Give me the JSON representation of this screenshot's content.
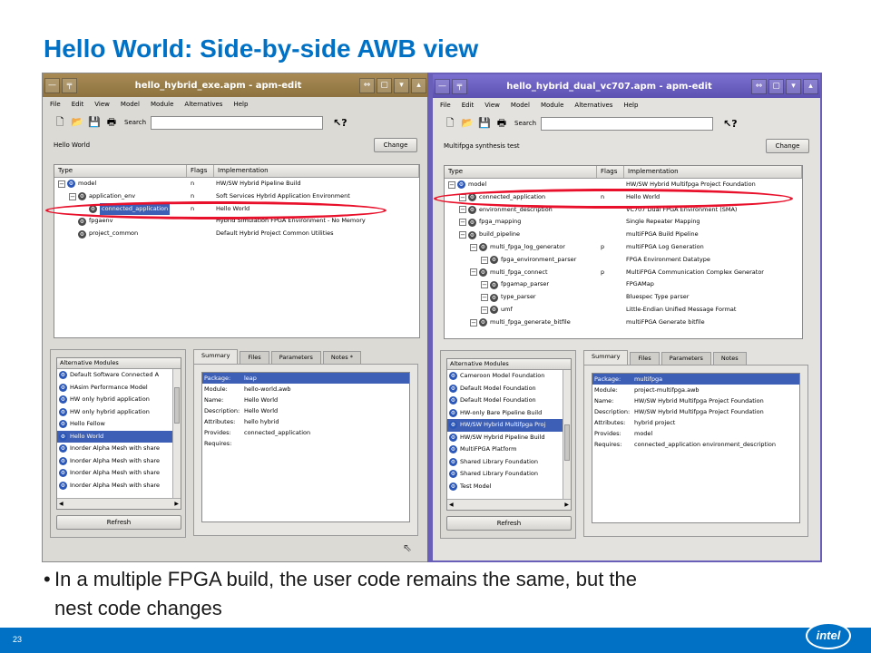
{
  "slide": {
    "title": "Hello World: Side-by-side AWB view",
    "bullet_marker": "•",
    "bullet_line1": "In a multiple FPGA build, the user code remains the same, but the",
    "bullet_line2": "nest code changes",
    "page_number": "23",
    "logo_text": "intel",
    "colors": {
      "title": "#0071c5",
      "footer": "#0071c5",
      "highlight_ellipse": "#e8102a"
    }
  },
  "menu": [
    "File",
    "Edit",
    "View",
    "Model",
    "Module",
    "Alternatives",
    "Help"
  ],
  "search_label": "Search",
  "change_label": "Change",
  "refresh_label": "Refresh",
  "columns": {
    "type": "Type",
    "flags": "Flags",
    "impl": "Implementation"
  },
  "alt_header": "Alternative Modules",
  "tabs": [
    "Summary",
    "Files",
    "Parameters",
    "Notes"
  ],
  "left": {
    "title": "hello_hybrid_exe.apm - apm-edit",
    "description": "Hello World",
    "tree": [
      {
        "name": "model",
        "flag": "n",
        "impl": "HW/SW Hybrid Pipeline Build"
      },
      {
        "name": "application_env",
        "flag": "n",
        "impl": "Soft Services Hybrid Application Environment"
      },
      {
        "name": "connected_application",
        "flag": "n",
        "impl": "Hello World"
      },
      {
        "name": "fpgaenv",
        "flag": "",
        "impl": "Hybrid Simulation FPGA Environment - No Memory"
      },
      {
        "name": "project_common",
        "flag": "",
        "impl": "Default Hybrid Project Common Utilities"
      }
    ],
    "alternatives": [
      "Default Software Connected A",
      "HAsim Performance Model",
      "HW only hybrid application",
      "HW only hybrid application",
      "Hello Fellow",
      "Hello World",
      "Inorder Alpha Mesh with share",
      "Inorder Alpha Mesh with share",
      "Inorder Alpha Mesh with share",
      "Inorder Alpha Mesh with share"
    ],
    "summary": [
      {
        "k": "Package:",
        "v": "leap"
      },
      {
        "k": "Module:",
        "v": "hello-world.awb"
      },
      {
        "k": "Name:",
        "v": "Hello World"
      },
      {
        "k": "Description:",
        "v": "Hello World"
      },
      {
        "k": "Attributes:",
        "v": "hello hybrid"
      },
      {
        "k": "Provides:",
        "v": "connected_application"
      },
      {
        "k": "Requires:",
        "v": ""
      }
    ]
  },
  "right": {
    "title": "hello_hybrid_dual_vc707.apm - apm-edit",
    "description": "Multifpga synthesis test",
    "tree": [
      {
        "name": "model",
        "flag": "",
        "impl": "HW/SW Hybrid Multifpga Project Foundation"
      },
      {
        "name": "connected_application",
        "flag": "n",
        "impl": "Hello World"
      },
      {
        "name": "environment_description",
        "flag": "",
        "impl": "VC707 Dual FPGA Environment (SMA)"
      },
      {
        "name": "fpga_mapping",
        "flag": "",
        "impl": "Single Repeater Mapping"
      },
      {
        "name": "build_pipeline",
        "flag": "",
        "impl": "multiFPGA Build Pipeline"
      },
      {
        "name": "multi_fpga_log_generator",
        "flag": "p",
        "impl": "multiFPGA Log Generation"
      },
      {
        "name": "fpga_environment_parser",
        "flag": "",
        "impl": "FPGA Environment Datatype"
      },
      {
        "name": "multi_fpga_connect",
        "flag": "p",
        "impl": "MultiFPGA Communication Complex Generator"
      },
      {
        "name": "fpgamap_parser",
        "flag": "",
        "impl": "FPGAMap"
      },
      {
        "name": "type_parser",
        "flag": "",
        "impl": "Bluespec Type parser"
      },
      {
        "name": "umf",
        "flag": "",
        "impl": "Little-Endian Unified Message Format"
      },
      {
        "name": "multi_fpga_generate_bitfile",
        "flag": "",
        "impl": "multiFPGA Generate bitfile"
      }
    ],
    "alternatives": [
      "Cameroon Model Foundation",
      "Default Model Foundation",
      "Default Model Foundation",
      "HW-only Bare Pipeline Build",
      "HW/SW Hybrid Multifpga Proj",
      "HW/SW Hybrid Pipeline Build",
      "MultiFPGA Platform",
      "Shared Library Foundation",
      "Shared Library Foundation",
      "Test Model"
    ],
    "summary": [
      {
        "k": "Package:",
        "v": "multifpga"
      },
      {
        "k": "Module:",
        "v": "project-multifpga.awb"
      },
      {
        "k": "Name:",
        "v": "HW/SW Hybrid Multifpga Project Foundation"
      },
      {
        "k": "Description:",
        "v": "HW/SW Hybrid Multifpga Project Foundation"
      },
      {
        "k": "Attributes:",
        "v": "hybrid project"
      },
      {
        "k": "Provides:",
        "v": "model"
      },
      {
        "k": "Requires:",
        "v": "connected_application environment_description"
      }
    ]
  }
}
